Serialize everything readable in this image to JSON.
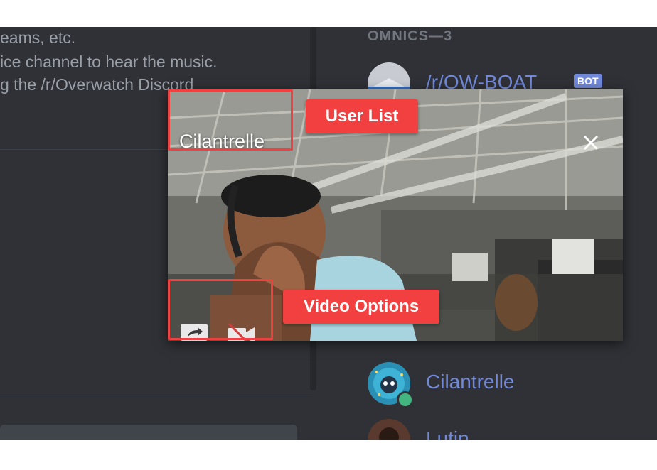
{
  "chat": {
    "lines": [
      "eams, etc.",
      "ice channel to hear the music.",
      "g the /r/Overwatch Discord"
    ]
  },
  "members": {
    "section_title": "OMNICS—3",
    "list": [
      {
        "name": "/r/OW-BOAT",
        "tag": "BOT"
      },
      {
        "name": "Cilantrelle"
      },
      {
        "name": "Lutin"
      }
    ]
  },
  "video": {
    "user_name": "Cilantrelle",
    "close_glyph": "✕",
    "annotations": {
      "user_list_label": "User List",
      "video_options_label": "Video Options"
    },
    "icons": [
      "screen-share-icon",
      "video-off-icon",
      "close-icon"
    ]
  },
  "colors": {
    "background": "#36393f",
    "panel": "#2f3136",
    "blurple": "#7289da",
    "annotation_red": "#f23f3f",
    "online_green": "#43b581"
  }
}
